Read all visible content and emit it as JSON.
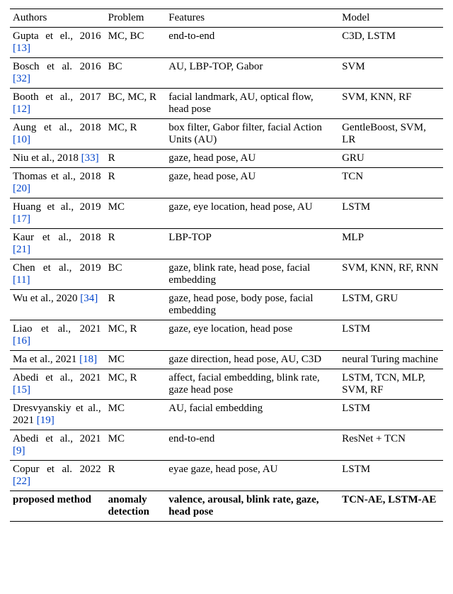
{
  "chart_data": {
    "type": "table",
    "title": "",
    "columns": [
      "Authors",
      "Problem",
      "Features",
      "Model"
    ],
    "rows": [
      {
        "authors": {
          "text": "Gupta et el., 2016",
          "cite": "[13]"
        },
        "problem": "MC, BC",
        "features": "end-to-end",
        "model": "C3D, LSTM"
      },
      {
        "authors": {
          "text": "Bosch et al. 2016",
          "cite": "[32]"
        },
        "problem": "BC",
        "features": "AU, LBP-TOP, Gabor",
        "model": "SVM"
      },
      {
        "authors": {
          "text": "Booth et al., 2017",
          "cite": "[12]"
        },
        "problem": "BC, MC, R",
        "features": "facial landmark, AU, optical flow, head pose",
        "model": "SVM, KNN, RF"
      },
      {
        "authors": {
          "text": "Aung et al., 2018",
          "cite": "[10]"
        },
        "problem": "MC, R",
        "features": "box filter, Gabor filter, facial Action Units (AU)",
        "model": "GentleBoost, SVM, LR"
      },
      {
        "authors": {
          "text": "Niu et al., 2018",
          "cite": "[33]"
        },
        "problem": "R",
        "features": "gaze, head pose, AU",
        "model": "GRU"
      },
      {
        "authors": {
          "text": "Thomas et al., 2018",
          "cite": "[20]"
        },
        "problem": "R",
        "features": "gaze, head pose, AU",
        "model": "TCN"
      },
      {
        "authors": {
          "text": "Huang et al., 2019",
          "cite": "[17]"
        },
        "problem": "MC",
        "features": "gaze, eye location, head pose, AU",
        "model": "LSTM"
      },
      {
        "authors": {
          "text": "Kaur et al., 2018",
          "cite": "[21]"
        },
        "problem": "R",
        "features": "LBP-TOP",
        "model": "MLP"
      },
      {
        "authors": {
          "text": "Chen et al., 2019",
          "cite": "[11]"
        },
        "problem": "BC",
        "features": "gaze, blink rate, head pose, facial embedding",
        "model": "SVM, KNN, RF, RNN"
      },
      {
        "authors": {
          "text": "Wu et al., 2020",
          "cite": "[34]"
        },
        "problem": "R",
        "features": "gaze, head pose, body pose, facial embedding",
        "model": "LSTM, GRU"
      },
      {
        "authors": {
          "text": "Liao et al., 2021",
          "cite": "[16]"
        },
        "problem": "MC, R",
        "features": "gaze, eye location, head pose",
        "model": "LSTM"
      },
      {
        "authors": {
          "text": "Ma et al., 2021",
          "cite": "[18]"
        },
        "problem": "MC",
        "features": "gaze direction, head pose, AU, C3D",
        "model": "neural Turing machine"
      },
      {
        "authors": {
          "text": "Abedi et al., 2021",
          "cite": "[15]"
        },
        "problem": "MC, R",
        "features": "affect, facial embedding, blink rate, gaze head pose",
        "model": "LSTM, TCN, MLP, SVM, RF"
      },
      {
        "authors": {
          "text": "Dresvyanskiy et al., 2021",
          "cite": "[19]"
        },
        "problem": "MC",
        "features": "AU, facial embedding",
        "model": "LSTM"
      },
      {
        "authors": {
          "text": "Abedi et al., 2021",
          "cite": "[9]"
        },
        "problem": "MC",
        "features": "end-to-end",
        "model": "ResNet + TCN"
      },
      {
        "authors": {
          "text": "Copur et al. 2022",
          "cite": "[22]"
        },
        "problem": "R",
        "features": "eyae gaze, head pose, AU",
        "model": "LSTM"
      },
      {
        "authors": {
          "text": "proposed method",
          "cite": ""
        },
        "problem": "anomaly detection",
        "features": "valence, arousal, blink rate, gaze, head pose",
        "model": "TCN-AE, LSTM-AE",
        "bold": true
      }
    ]
  },
  "headers": {
    "authors": "Authors",
    "problem": "Problem",
    "features": "Features",
    "model": "Model"
  }
}
